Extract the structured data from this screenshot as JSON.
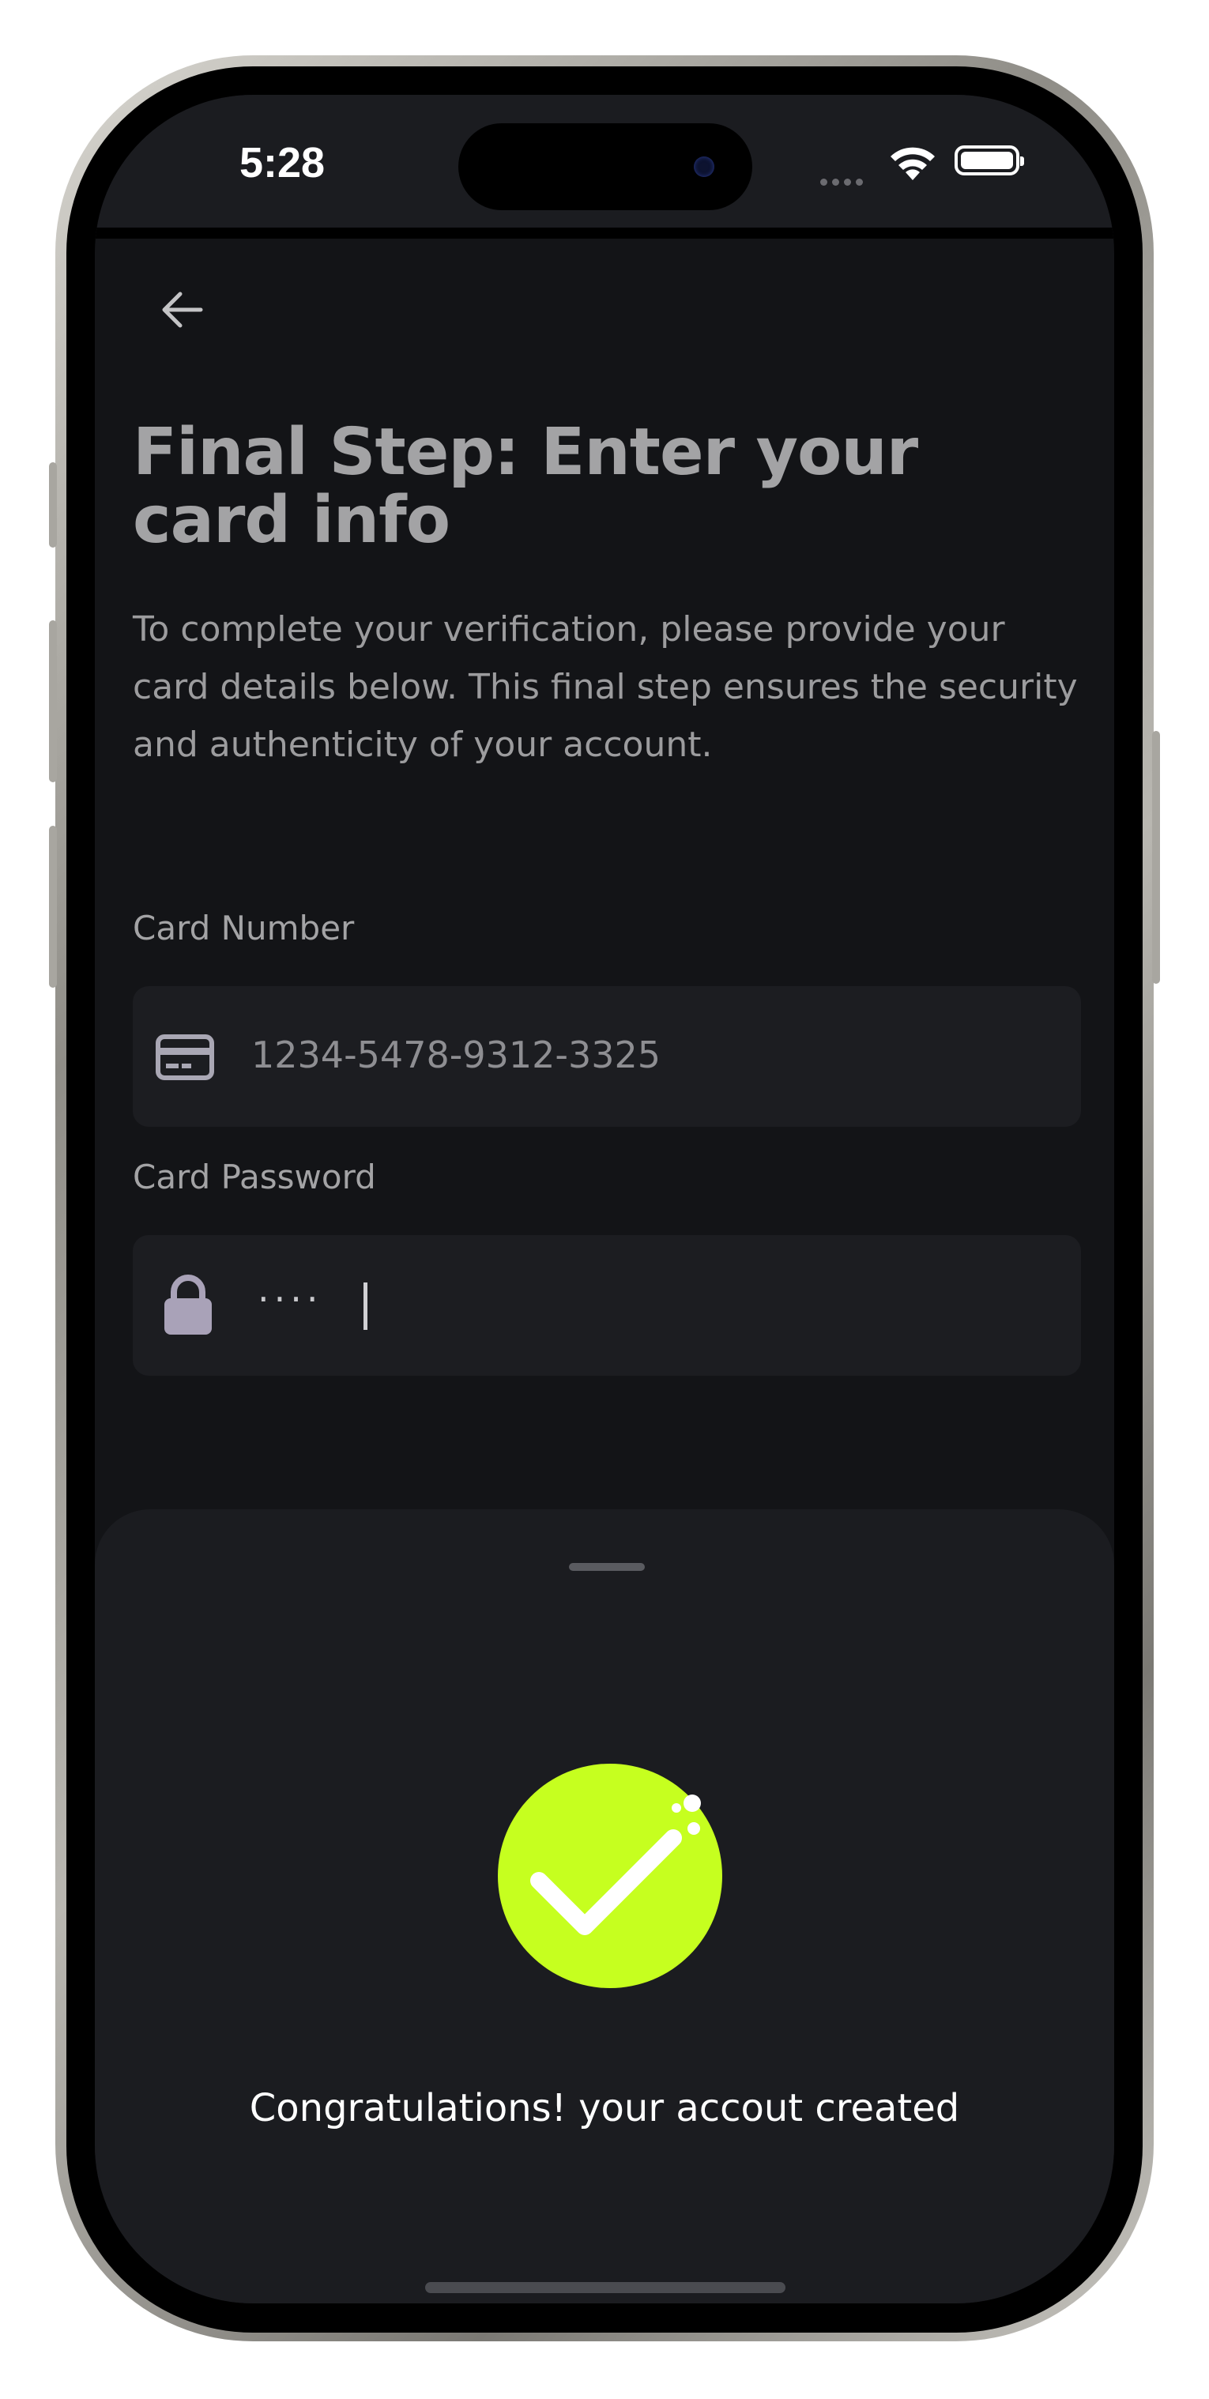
{
  "status_bar": {
    "time": "5:28",
    "wifi_icon": "wifi-icon",
    "battery_icon": "battery-full-icon"
  },
  "header": {
    "back_icon": "arrow-left-icon"
  },
  "main": {
    "title": "Final Step: Enter your card info",
    "description": "To complete your verification, please provide your card details below. This final step ensures the security and authenticity of your account.",
    "card_number": {
      "label": "Card Number",
      "icon": "credit-card-icon",
      "value": "1234-5478-9312-3325"
    },
    "card_password": {
      "label": "Card Password",
      "icon": "lock-icon",
      "masked_value": "····"
    }
  },
  "sheet": {
    "icon": "check-circle-icon",
    "message": "Congratulations! your accout created"
  },
  "colors": {
    "background": "#131417",
    "surface": "#1c1d21",
    "accent": "#c6ff1f",
    "text_primary": "#ffffff",
    "text_muted": "#a3a3a5"
  }
}
